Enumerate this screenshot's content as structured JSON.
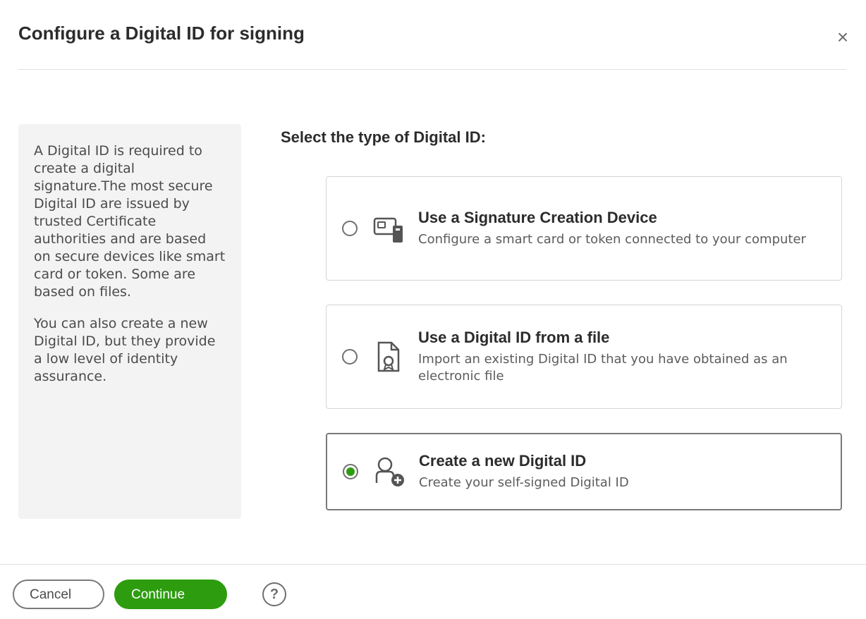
{
  "dialog": {
    "title": "Configure a Digital ID for signing",
    "close_label": "×"
  },
  "info_panel": {
    "text1": "A Digital ID is required to create a digital signature.The most secure Digital ID are issued by trusted Certificate authorities and are based on secure devices like smart card or token. Some are based on files.",
    "text2": "You can also create a new Digital ID, but they provide a low level of identity assurance."
  },
  "selection": {
    "label": "Select the type of Digital ID:",
    "options": [
      {
        "title": "Use a Signature Creation Device",
        "description": "Configure a smart card or token connected to your computer",
        "icon": "smart-card-icon",
        "selected": false
      },
      {
        "title": "Use a Digital ID from a file",
        "description": "Import an existing Digital ID that you have obtained as an electronic file",
        "icon": "file-certificate-icon",
        "selected": false
      },
      {
        "title": "Create a new Digital ID",
        "description": "Create your self-signed Digital ID",
        "icon": "new-id-icon",
        "selected": true
      }
    ]
  },
  "footer": {
    "cancel_label": "Cancel",
    "continue_label": "Continue",
    "help_label": "?"
  },
  "colors": {
    "accent": "#2d9d0f",
    "border": "#d5d5d5",
    "panel_bg": "#f3f3f3"
  }
}
